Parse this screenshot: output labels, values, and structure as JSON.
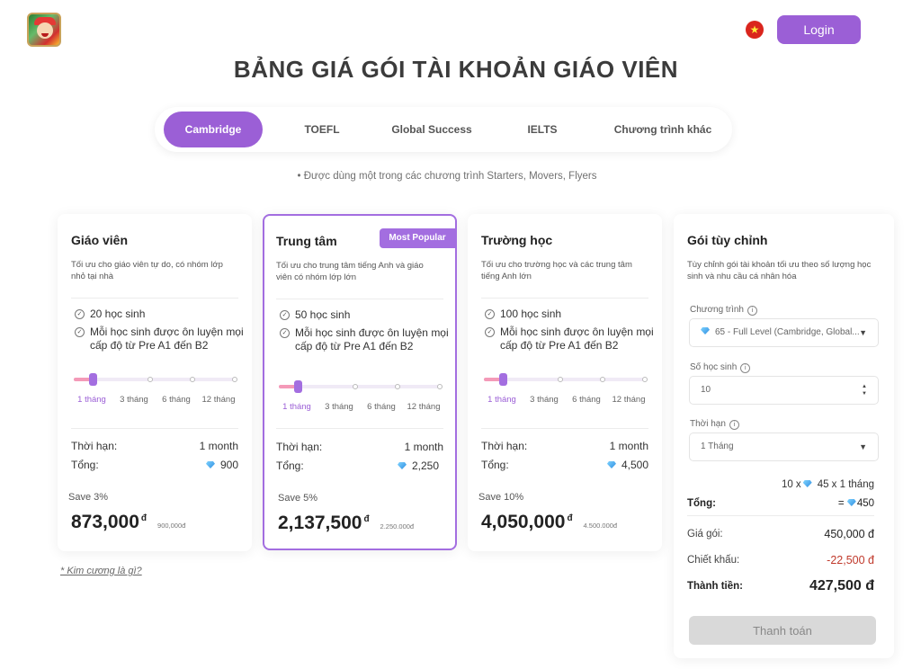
{
  "header": {
    "login_label": "Login",
    "language_flag": "vietnam-flag"
  },
  "page_title": "BẢNG GIÁ GÓI TÀI KHOẢN GIÁO VIÊN",
  "tabs": [
    {
      "label": "Cambridge",
      "active": true
    },
    {
      "label": "TOEFL",
      "active": false
    },
    {
      "label": "Global Success",
      "active": false
    },
    {
      "label": "IELTS",
      "active": false
    },
    {
      "label": "Chương trình khác",
      "active": false
    }
  ],
  "program_note": "•  Được dùng một trong các chương trình Starters, Movers, Flyers",
  "plans": [
    {
      "title": "Giáo viên",
      "badge": "",
      "description": "Tối ưu cho giáo viên tự do, có nhóm lớp nhỏ tại nhà",
      "features": [
        "20 học sinh",
        "Mỗi học sinh được ôn luyện mọi cấp độ từ Pre A1 đến B2"
      ],
      "durations": [
        "1 tháng",
        "3 tháng",
        "6 tháng",
        "12 tháng"
      ],
      "selected_duration_index": 0,
      "term_label": "Thời hạn:",
      "term_value": "1 month",
      "total_label": "Tổng:",
      "total_value": "900",
      "save": "Save 3%",
      "price": "873,000",
      "currency": "đ",
      "original_price": "900,000đ"
    },
    {
      "title": "Trung tâm",
      "badge": "Most Popular",
      "description": "Tối ưu cho trung tâm tiếng Anh và giáo viên có nhóm lớp lớn",
      "features": [
        "50 học sinh",
        "Mỗi học sinh được ôn luyện mọi cấp độ từ Pre A1 đến B2"
      ],
      "durations": [
        "1 tháng",
        "3 tháng",
        "6 tháng",
        "12 tháng"
      ],
      "selected_duration_index": 0,
      "term_label": "Thời hạn:",
      "term_value": "1 month",
      "total_label": "Tổng:",
      "total_value": "2,250",
      "save": "Save 5%",
      "price": "2,137,500",
      "currency": "đ",
      "original_price": "2.250.000đ"
    },
    {
      "title": "Trường học",
      "badge": "",
      "description": "Tối ưu cho trường học và các trung tâm tiếng Anh lớn",
      "features": [
        "100 học sinh",
        "Mỗi học sinh được ôn luyện mọi cấp độ từ Pre A1 đến B2"
      ],
      "durations": [
        "1 tháng",
        "3 tháng",
        "6 tháng",
        "12 tháng"
      ],
      "selected_duration_index": 0,
      "term_label": "Thời hạn:",
      "term_value": "1 month",
      "total_label": "Tổng:",
      "total_value": "4,500",
      "save": "Save 10%",
      "price": "4,050,000",
      "currency": "đ",
      "original_price": "4.500.000đ"
    }
  ],
  "diamond_link": "* Kim cương là gì?",
  "custom": {
    "title": "Gói tùy chỉnh",
    "description": "Tùy chỉnh gói tài khoản tối ưu theo số lượng học sinh và nhu cầu cá nhân hóa",
    "program_label": "Chương trình",
    "program_value": "65 - Full Level (Cambridge, Global...",
    "students_label": "Số học sinh",
    "students_value": "10",
    "term_label": "Thời hạn",
    "term_value": "1 Tháng",
    "calc_left": "10 x",
    "calc_right": "45 x 1 tháng",
    "total_label": "Tổng:",
    "total_value": "450",
    "total_prefix": "=",
    "package_price_label": "Giá gói:",
    "package_price_value": "450,000 đ",
    "discount_label": "Chiết khấu:",
    "discount_value": "-22,500 đ",
    "final_label": "Thành tiền:",
    "final_value": "427,500 đ",
    "pay_label": "Thanh toán"
  },
  "colors": {
    "accent": "#9b5fd6",
    "discount": "#c0392b",
    "slider_fill": "#f49ab8"
  }
}
